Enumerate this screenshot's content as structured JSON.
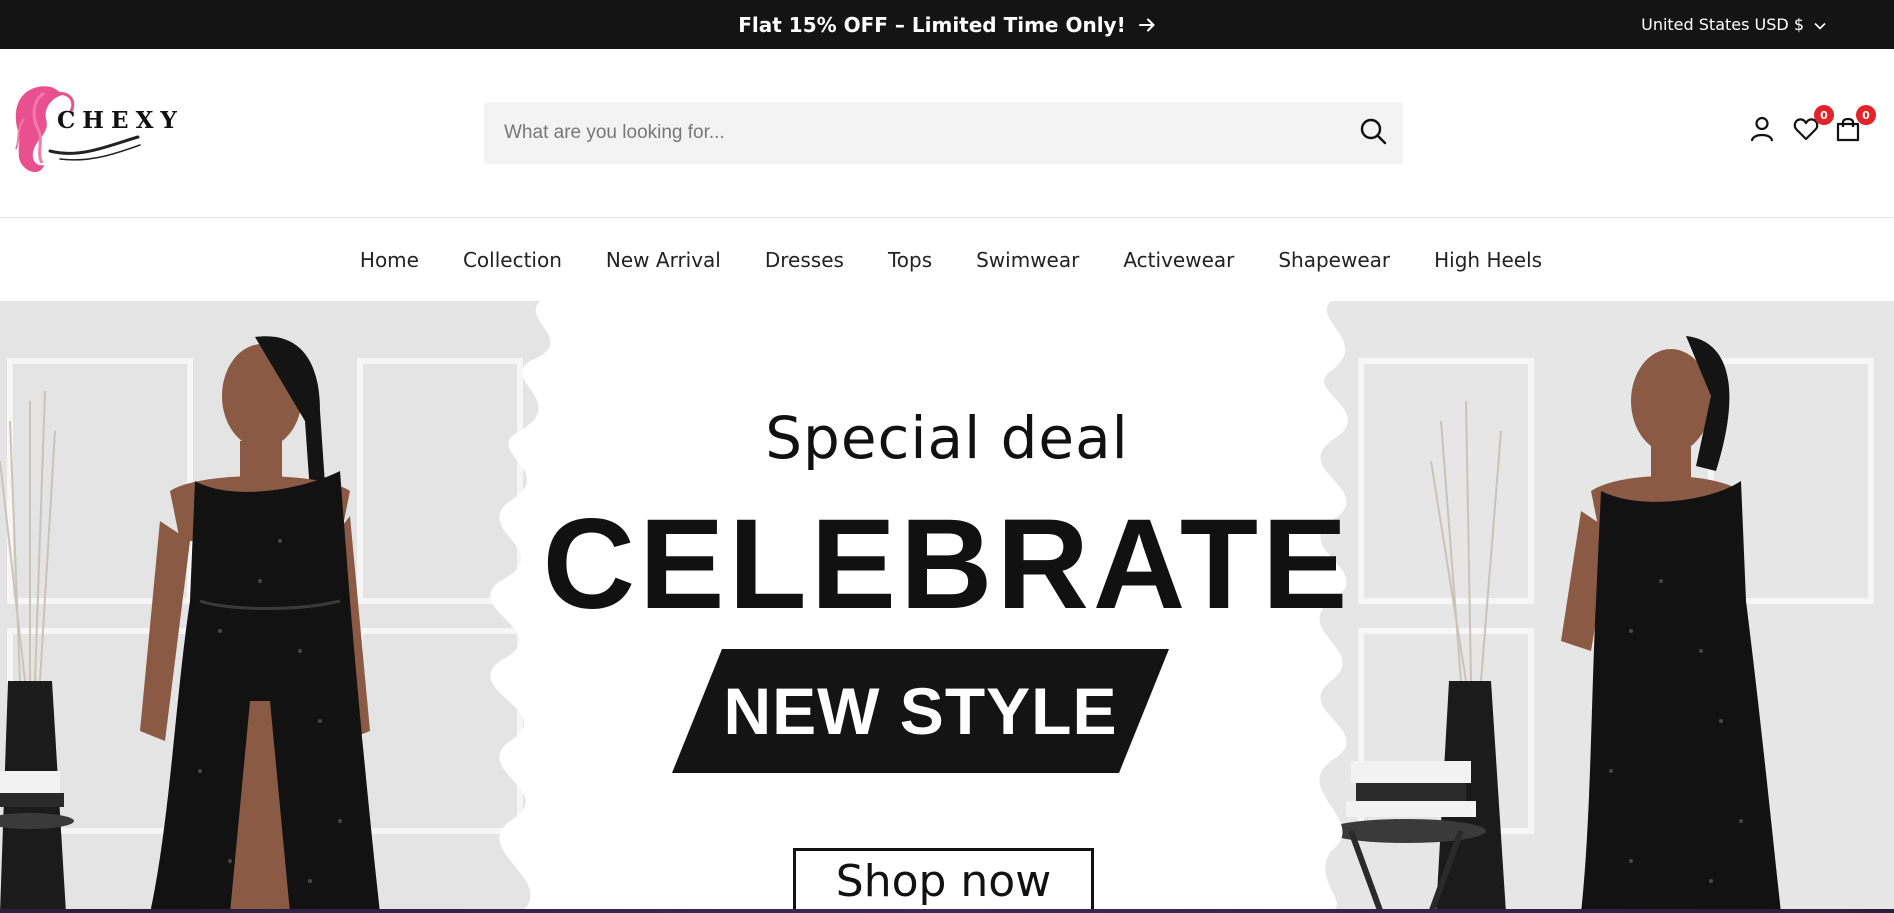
{
  "announcement": {
    "text": "Flat 15% OFF – Limited Time Only!",
    "currency": "United States USD $"
  },
  "header": {
    "logo_text": "CHEXY",
    "search_placeholder": "What are you looking for...",
    "wishlist_count": "0",
    "cart_count": "0"
  },
  "nav": {
    "items": [
      "Home",
      "Collection",
      "New Arrival",
      "Dresses",
      "Tops",
      "Swimwear",
      "Activewear",
      "Shapewear",
      "High Heels"
    ]
  },
  "hero": {
    "kicker": "Special deal",
    "headline": "CELEBRATE",
    "tagline": "NEW STYLE",
    "cta": "Shop now"
  },
  "colors": {
    "announcement_bg": "#141414",
    "badge": "#e2232a",
    "logo_pink": "#e8508f",
    "search_bg": "#f3f3f3"
  },
  "icons": {
    "announcement": "arrow-right-icon",
    "currency": "chevron-down-icon",
    "search": "search-icon",
    "account": "user-icon",
    "wishlist": "heart-icon",
    "cart": "shopping-bag-icon"
  }
}
